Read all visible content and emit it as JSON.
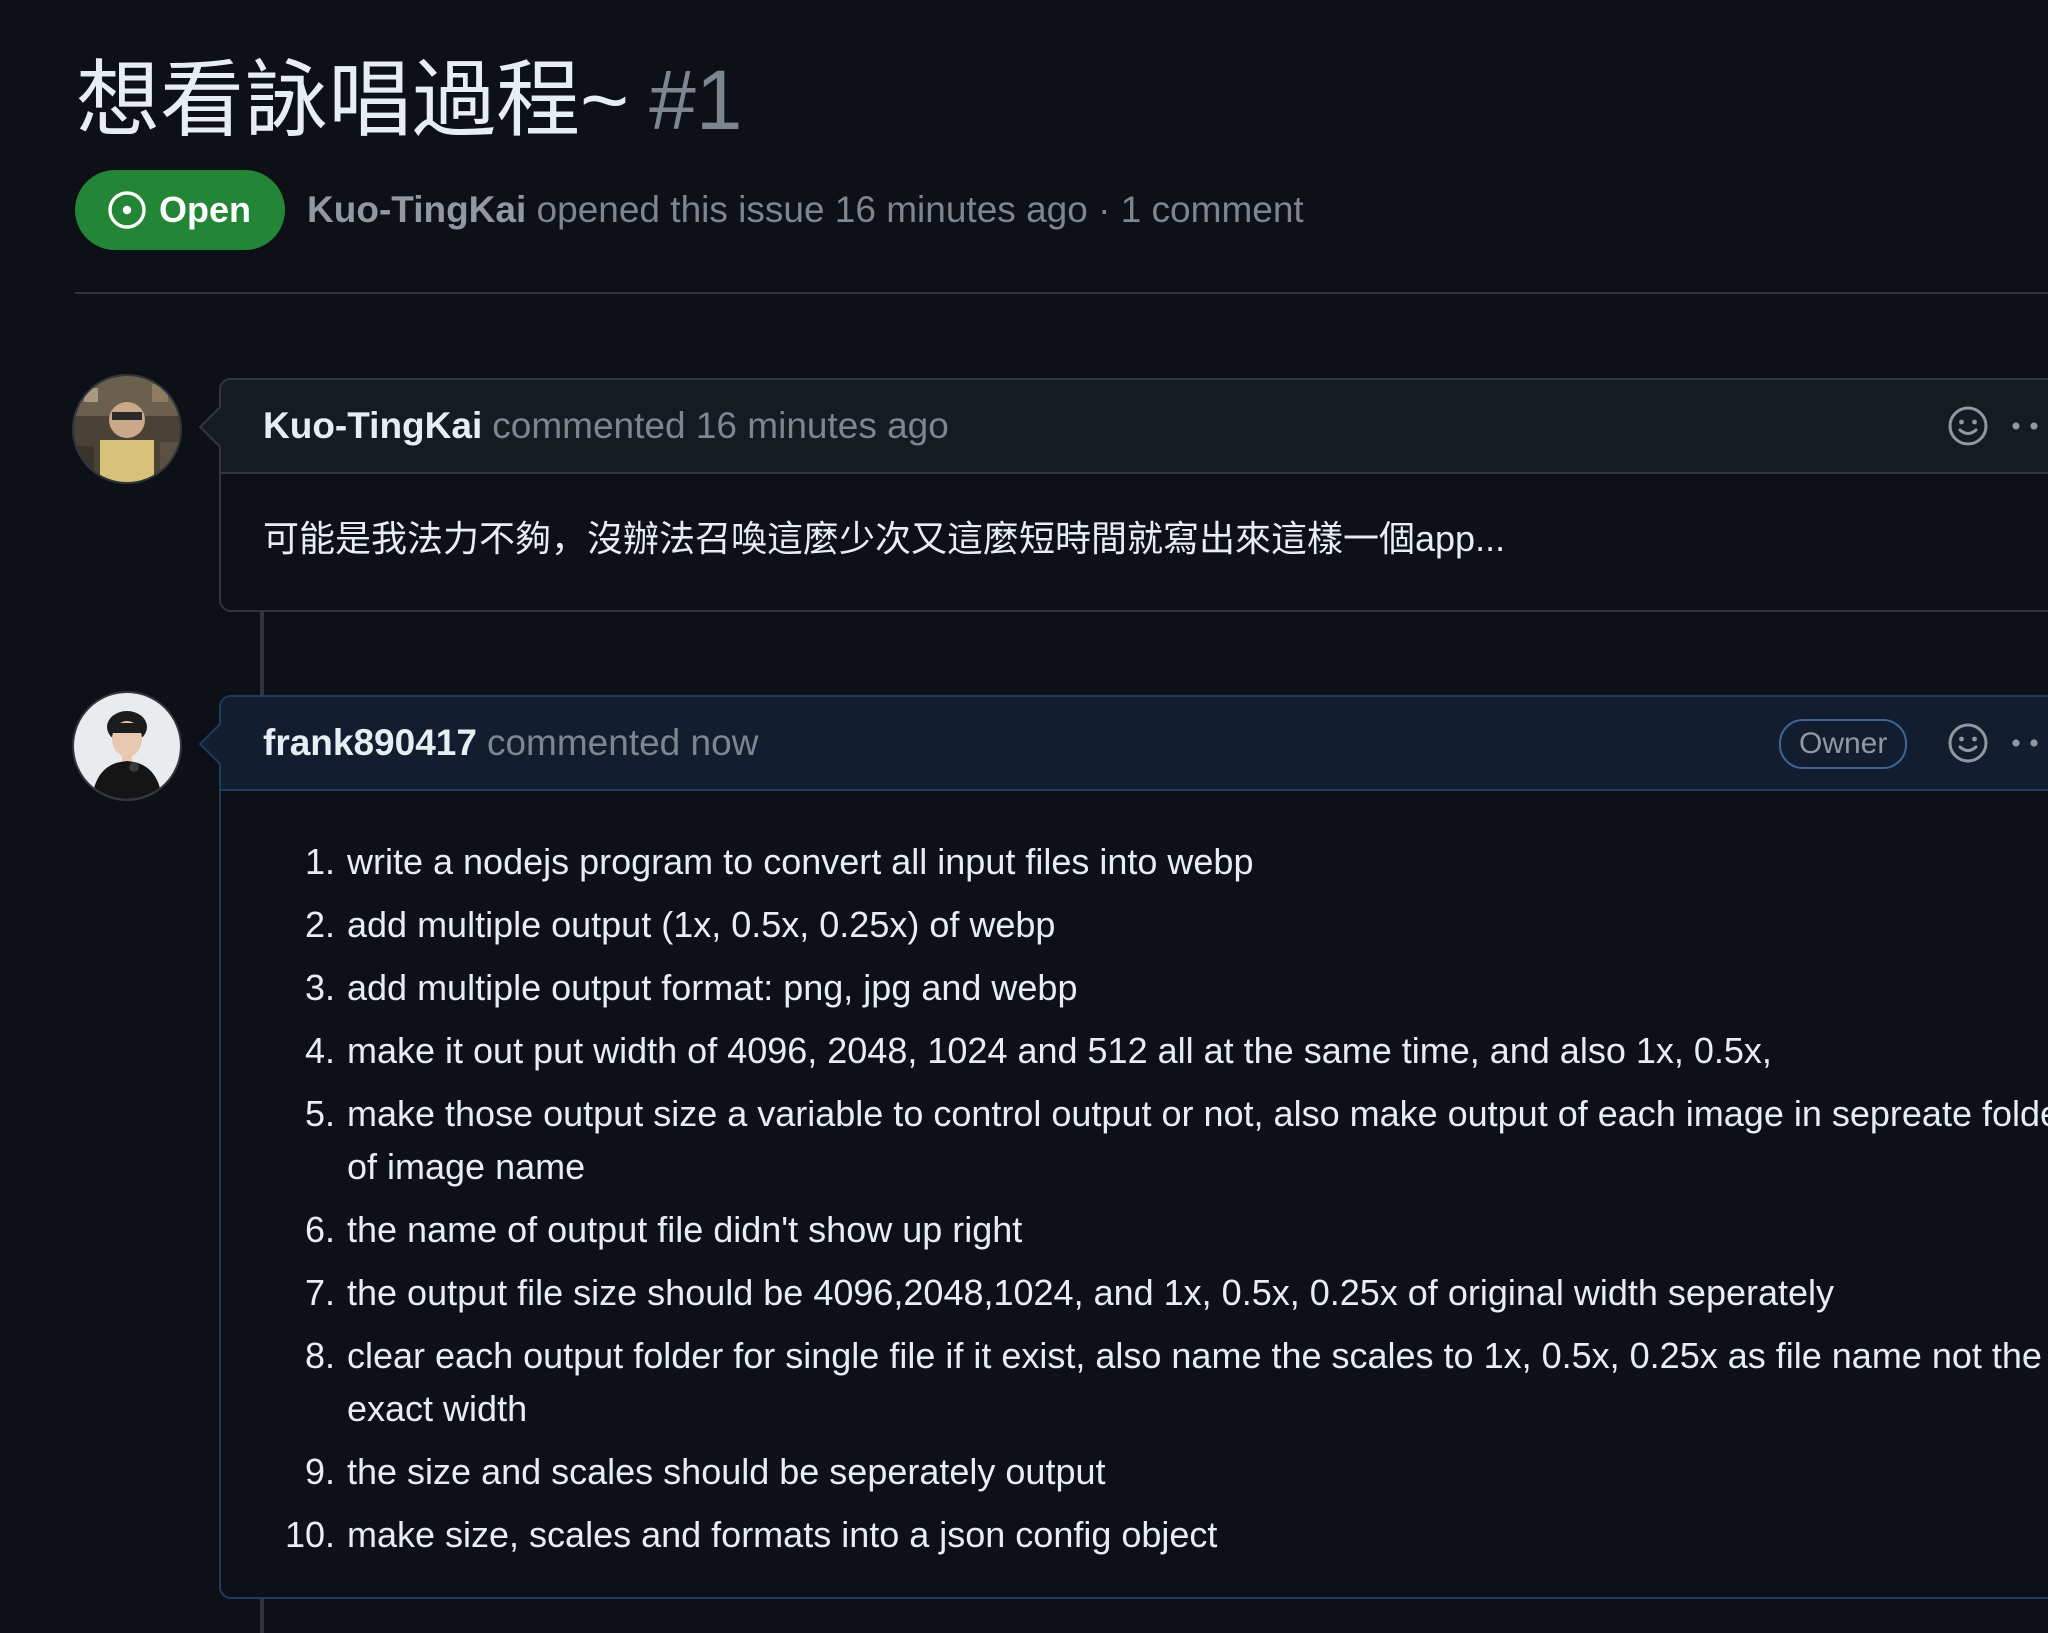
{
  "issue": {
    "title": "想看詠唱過程~",
    "number": "#1",
    "state": "Open",
    "author": "Kuo-TingKai",
    "meta_text": "opened this issue 16 minutes ago · 1 comment"
  },
  "comments": [
    {
      "author": "Kuo-TingKai",
      "action": "commented 16 minutes ago",
      "body": "可能是我法力不夠，沒辦法召喚這麼少次又這麼短時間就寫出來這樣一個app..."
    },
    {
      "author": "frank890417",
      "action": "commented now",
      "badge": "Owner",
      "steps": [
        {
          "n": "1.",
          "text": "write a nodejs program to convert all input files into webp"
        },
        {
          "n": "2.",
          "text": "add multiple output (1x, 0.5x, 0.25x) of webp"
        },
        {
          "n": "3.",
          "text": "add multiple output format: png, jpg and webp"
        },
        {
          "n": "4.",
          "text": "make it out put width of 4096, 2048, 1024 and 512 all at the same time, and also 1x, 0.5x,"
        },
        {
          "n": "5.",
          "text": "make those output size a variable to control output or not, also make output of each image in sepreate folder of image name"
        },
        {
          "n": "6.",
          "text": "the name of output file didn't show up right"
        },
        {
          "n": "7.",
          "text": "the output file size should be 4096,2048,1024, and 1x, 0.5x, 0.25x of original width seperately"
        },
        {
          "n": "8.",
          "text": "clear each output folder for single file if it exist, also name the scales to 1x, 0.5x, 0.25x as file name not the exact width"
        },
        {
          "n": "9.",
          "text": "the size and scales should be seperately output"
        },
        {
          "n": "10.",
          "text": "make size, scales and formats into a json config object"
        }
      ]
    }
  ],
  "colors": {
    "background": "#0d1117",
    "open_green": "#238636",
    "owner_header": "#121d2f",
    "muted_text": "#7d8590"
  },
  "icons": [
    "issue-opened-icon",
    "smiley-icon",
    "kebab-horizontal-icon"
  ]
}
